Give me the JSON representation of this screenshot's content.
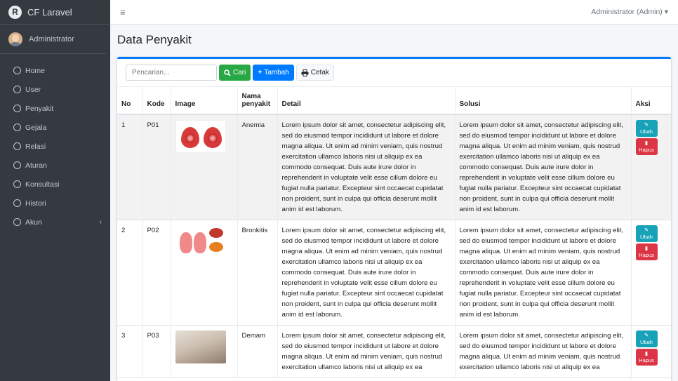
{
  "brand": {
    "title": "CF Laravel",
    "logo_letter": "R"
  },
  "user": {
    "name": "Administrator"
  },
  "topbar": {
    "menu_icon": "hamburger-icon",
    "user_menu": "Administrator (Admin)",
    "user_menu_caret": "▾"
  },
  "sidebar": {
    "items": [
      {
        "label": "Home"
      },
      {
        "label": "User"
      },
      {
        "label": "Penyakit"
      },
      {
        "label": "Gejala"
      },
      {
        "label": "Relasi"
      },
      {
        "label": "Aturan"
      },
      {
        "label": "Konsultasi"
      },
      {
        "label": "Histori"
      },
      {
        "label": "Akun",
        "chevron": "‹"
      }
    ]
  },
  "page": {
    "title": "Data Penyakit"
  },
  "toolbar": {
    "search_placeholder": "Pencarian...",
    "cari_label": "Cari",
    "tambah_label": "Tambah",
    "cetak_label": "Cetak"
  },
  "table": {
    "headers": {
      "no": "No",
      "kode": "Kode",
      "image": "Image",
      "nama": "Nama penyakit",
      "detail": "Detail",
      "solusi": "Solusi",
      "aksi": "Aksi"
    },
    "rows": [
      {
        "no": "1",
        "kode": "P01",
        "nama": "Anemia",
        "detail": "Lorem ipsum dolor sit amet, consectetur adipiscing elit, sed do eiusmod tempor incididunt ut labore et dolore magna aliqua. Ut enim ad minim veniam, quis nostrud exercitation ullamco laboris nisi ut aliquip ex ea commodo consequat. Duis aute irure dolor in reprehenderit in voluptate velit esse cillum dolore eu fugiat nulla pariatur. Excepteur sint occaecat cupidatat non proident, sunt in culpa qui officia deserunt mollit anim id est laborum.",
        "solusi": "Lorem ipsum dolor sit amet, consectetur adipiscing elit, sed do eiusmod tempor incididunt ut labore et dolore magna aliqua. Ut enim ad minim veniam, quis nostrud exercitation ullamco laboris nisi ut aliquip ex ea commodo consequat. Duis aute irure dolor in reprehenderit in voluptate velit esse cillum dolore eu fugiat nulla pariatur. Excepteur sint occaecat cupidatat non proident, sunt in culpa qui officia deserunt mollit anim id est laborum.",
        "ubah": "Ubah",
        "hapus": "Hapus"
      },
      {
        "no": "2",
        "kode": "P02",
        "nama": "Bronkitis",
        "detail": "Lorem ipsum dolor sit amet, consectetur adipiscing elit, sed do eiusmod tempor incididunt ut labore et dolore magna aliqua. Ut enim ad minim veniam, quis nostrud exercitation ullamco laboris nisi ut aliquip ex ea commodo consequat. Duis aute irure dolor in reprehenderit in voluptate velit esse cillum dolore eu fugiat nulla pariatur. Excepteur sint occaecat cupidatat non proident, sunt in culpa qui officia deserunt mollit anim id est laborum.",
        "solusi": "Lorem ipsum dolor sit amet, consectetur adipiscing elit, sed do eiusmod tempor incididunt ut labore et dolore magna aliqua. Ut enim ad minim veniam, quis nostrud exercitation ullamco laboris nisi ut aliquip ex ea commodo consequat. Duis aute irure dolor in reprehenderit in voluptate velit esse cillum dolore eu fugiat nulla pariatur. Excepteur sint occaecat cupidatat non proident, sunt in culpa qui officia deserunt mollit anim id est laborum.",
        "ubah": "Ubah",
        "hapus": "Hapus"
      },
      {
        "no": "3",
        "kode": "P03",
        "nama": "Demam",
        "detail": "Lorem ipsum dolor sit amet, consectetur adipiscing elit, sed do eiusmod tempor incididunt ut labore et dolore magna aliqua. Ut enim ad minim veniam, quis nostrud exercitation ullamco laboris nisi ut aliquip ex ea",
        "solusi": "Lorem ipsum dolor sit amet, consectetur adipiscing elit, sed do eiusmod tempor incididunt ut labore et dolore magna aliqua. Ut enim ad minim veniam, quis nostrud exercitation ullamco laboris nisi ut aliquip ex ea",
        "ubah": "Ubah",
        "hapus": "Hapus"
      }
    ]
  },
  "colors": {
    "sidebar": "#343a40",
    "primary": "#007bff",
    "success": "#28a745",
    "info": "#17a2b8",
    "danger": "#dc3545"
  }
}
